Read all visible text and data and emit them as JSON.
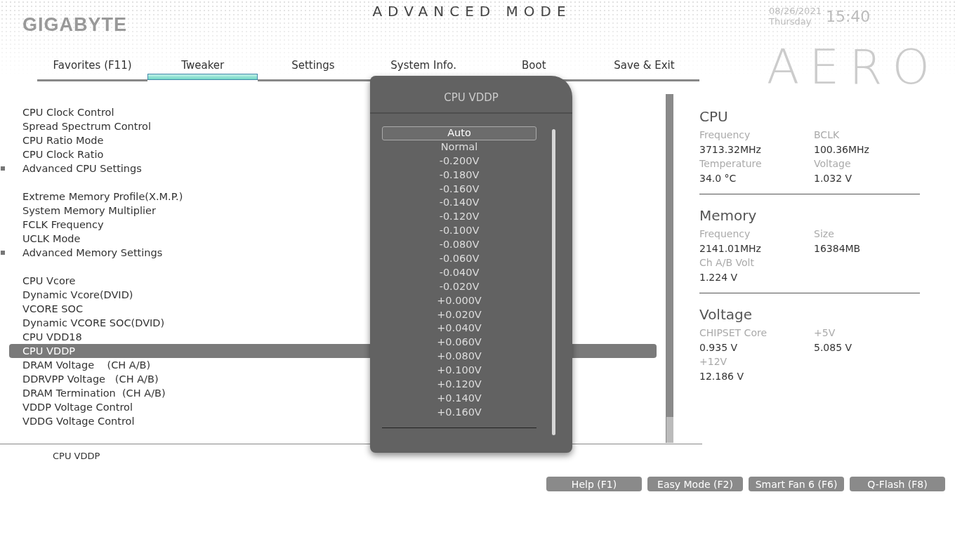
{
  "header": {
    "brand": "GIGABYTE",
    "mode_title": "ADVANCED MODE",
    "date": "08/26/2021",
    "weekday": "Thursday",
    "time": "15:40",
    "model_logo": "AERO"
  },
  "tabs": [
    {
      "label": "Favorites (F11)",
      "selected": false
    },
    {
      "label": "Tweaker",
      "selected": true
    },
    {
      "label": "Settings",
      "selected": false
    },
    {
      "label": "System Info.",
      "selected": false
    },
    {
      "label": "Boot",
      "selected": false
    },
    {
      "label": "Save & Exit",
      "selected": false
    }
  ],
  "setting_groups": [
    {
      "items": [
        {
          "label": "CPU Clock Control",
          "kind": "item",
          "selected": false
        },
        {
          "label": "Spread Spectrum Control",
          "kind": "item",
          "selected": false
        },
        {
          "label": "CPU Ratio Mode",
          "kind": "item",
          "selected": false
        },
        {
          "label": "CPU Clock Ratio",
          "kind": "item",
          "selected": false
        },
        {
          "label": "Advanced CPU Settings",
          "kind": "submenu",
          "selected": false
        }
      ]
    },
    {
      "items": [
        {
          "label": "Extreme Memory Profile(X.M.P.)",
          "kind": "item",
          "selected": false
        },
        {
          "label": "System Memory Multiplier",
          "kind": "item",
          "selected": false
        },
        {
          "label": "FCLK Frequency",
          "kind": "item",
          "selected": false
        },
        {
          "label": "UCLK Mode",
          "kind": "item",
          "selected": false
        },
        {
          "label": "Advanced Memory Settings",
          "kind": "submenu",
          "selected": false
        }
      ]
    },
    {
      "items": [
        {
          "label": "CPU Vcore",
          "kind": "item",
          "selected": false
        },
        {
          "label": "Dynamic Vcore(DVID)",
          "kind": "item",
          "selected": false
        },
        {
          "label": "VCORE SOC",
          "kind": "item",
          "selected": false
        },
        {
          "label": "Dynamic VCORE SOC(DVID)",
          "kind": "item",
          "selected": false
        },
        {
          "label": "CPU VDD18",
          "kind": "item",
          "selected": false
        },
        {
          "label": "CPU VDDP",
          "kind": "item",
          "selected": true
        },
        {
          "label": "DRAM Voltage    (CH A/B)",
          "kind": "item",
          "selected": false
        },
        {
          "label": "DDRVPP Voltage   (CH A/B)",
          "kind": "item",
          "selected": false
        },
        {
          "label": "DRAM Termination  (CH A/B)",
          "kind": "item",
          "selected": false
        },
        {
          "label": "VDDP Voltage Control",
          "kind": "item",
          "selected": false
        },
        {
          "label": "VDDG Voltage Control",
          "kind": "item",
          "selected": false
        }
      ]
    }
  ],
  "help_text": "CPU VDDP",
  "popup": {
    "title": "CPU VDDP",
    "options": [
      {
        "label": "Auto",
        "selected": true
      },
      {
        "label": "Normal",
        "selected": false
      },
      {
        "label": "-0.200V",
        "selected": false
      },
      {
        "label": "-0.180V",
        "selected": false
      },
      {
        "label": "-0.160V",
        "selected": false
      },
      {
        "label": "-0.140V",
        "selected": false
      },
      {
        "label": "-0.120V",
        "selected": false
      },
      {
        "label": "-0.100V",
        "selected": false
      },
      {
        "label": "-0.080V",
        "selected": false
      },
      {
        "label": "-0.060V",
        "selected": false
      },
      {
        "label": "-0.040V",
        "selected": false
      },
      {
        "label": "-0.020V",
        "selected": false
      },
      {
        "label": "+0.000V",
        "selected": false
      },
      {
        "label": "+0.020V",
        "selected": false
      },
      {
        "label": "+0.040V",
        "selected": false
      },
      {
        "label": "+0.060V",
        "selected": false
      },
      {
        "label": "+0.080V",
        "selected": false
      },
      {
        "label": "+0.100V",
        "selected": false
      },
      {
        "label": "+0.120V",
        "selected": false
      },
      {
        "label": "+0.140V",
        "selected": false
      },
      {
        "label": "+0.160V",
        "selected": false
      }
    ]
  },
  "system_info": [
    {
      "title": "CPU",
      "fields": [
        {
          "label": "Frequency",
          "value": "3713.32MHz"
        },
        {
          "label": "BCLK",
          "value": "100.36MHz"
        },
        {
          "label": "Temperature",
          "value": "34.0 °C"
        },
        {
          "label": "Voltage",
          "value": "1.032 V"
        }
      ]
    },
    {
      "title": "Memory",
      "fields": [
        {
          "label": "Frequency",
          "value": "2141.01MHz"
        },
        {
          "label": "Size",
          "value": "16384MB"
        },
        {
          "label": "Ch A/B Volt",
          "value": "1.224 V"
        }
      ]
    },
    {
      "title": "Voltage",
      "fields": [
        {
          "label": "CHIPSET Core",
          "value": "0.935 V"
        },
        {
          "label": "+5V",
          "value": "5.085 V"
        },
        {
          "label": "+12V",
          "value": "12.186 V"
        }
      ]
    }
  ],
  "footer_buttons": [
    "Help (F1)",
    "Easy Mode (F2)",
    "Smart Fan 6 (F6)",
    "Q-Flash (F8)"
  ]
}
